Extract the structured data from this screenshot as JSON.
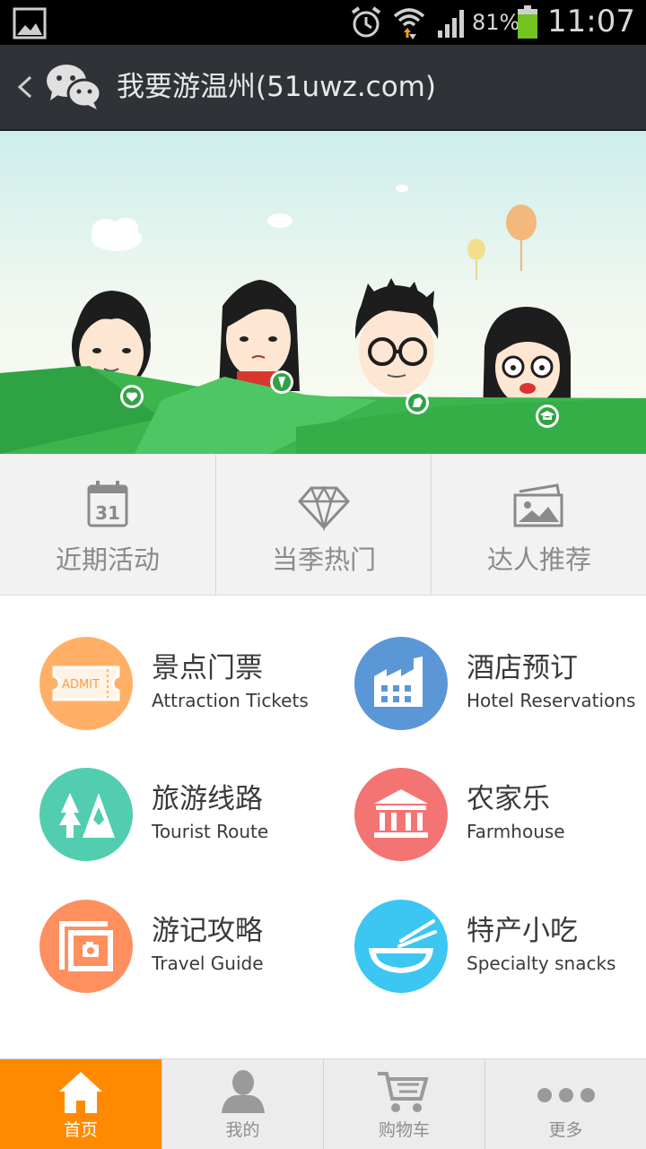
{
  "status_bar": {
    "battery": "81%",
    "time": "11:07",
    "icons": [
      "gallery-icon",
      "alarm-icon",
      "wifi-icon",
      "signal-icon",
      "battery-icon"
    ]
  },
  "title_bar": {
    "title": "我要游温州(51uwz.com)",
    "icons": [
      "back-chevron-icon",
      "wechat-icon"
    ]
  },
  "banner": {
    "icons": [
      "heart-badge-icon",
      "pen-badge-icon",
      "rooster-badge-icon",
      "graduation-cap-badge-icon"
    ]
  },
  "categories": [
    {
      "label": "近期活动",
      "icon": "calendar-icon",
      "calendar_day": "31"
    },
    {
      "label": "当季热门",
      "icon": "diamond-icon"
    },
    {
      "label": "达人推荐",
      "icon": "photos-icon"
    }
  ],
  "services": [
    {
      "cn": "景点门票",
      "en": "Attraction Tickets",
      "icon": "ticket-icon",
      "ticket_text": "ADMIT",
      "color": "#ffb066"
    },
    {
      "cn": "酒店预订",
      "en": "Hotel Reservations",
      "icon": "building-icon",
      "color": "#5b97d6"
    },
    {
      "cn": "旅游线路",
      "en": "Tourist Route",
      "icon": "mountain-trees-icon",
      "color": "#52cdb0"
    },
    {
      "cn": "农家乐",
      "en": "Farmhouse",
      "icon": "pavilion-icon",
      "color": "#f47474"
    },
    {
      "cn": "游记攻略",
      "en": "Travel Guide",
      "icon": "photo-frame-icon",
      "color": "#ff8f5e"
    },
    {
      "cn": "特产小吃",
      "en": "Specialty snacks",
      "icon": "noodle-bowl-icon",
      "color": "#3cc6f2"
    }
  ],
  "tabs": [
    {
      "label": "首页",
      "icon": "home-icon",
      "active": true
    },
    {
      "label": "我的",
      "icon": "user-icon",
      "active": false
    },
    {
      "label": "购物车",
      "icon": "cart-icon",
      "active": false
    },
    {
      "label": "更多",
      "icon": "more-dots-icon",
      "active": false
    }
  ],
  "colors": {
    "status_bar_bg": "#000000",
    "title_bar_bg": "#2f3236",
    "active_tab": "#ff8a00",
    "banner_green": "#3cb54a",
    "category_bg": "#f2f2f2"
  }
}
